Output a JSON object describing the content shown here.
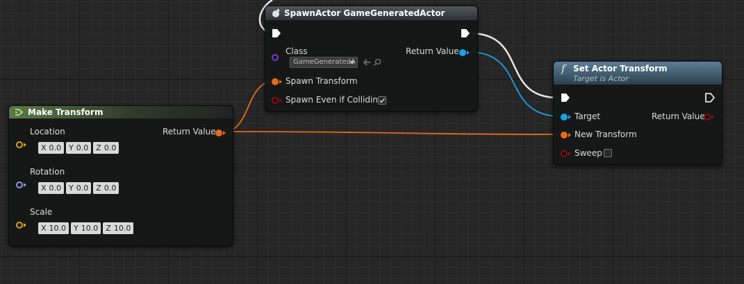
{
  "nodes": {
    "spawn_actor": {
      "title": "SpawnActor GameGeneratedActor",
      "pins": {
        "class_label": "Class",
        "class_value": "GameGeneratedA",
        "return_value": "Return Value",
        "spawn_transform": "Spawn Transform",
        "spawn_even_if_colliding": "Spawn Even if Colliding"
      },
      "spawn_even_if_colliding_checked": true
    },
    "make_transform": {
      "title": "Make Transform",
      "return_value": "Return Value",
      "location": {
        "label": "Location",
        "x": "0.0",
        "y": "0.0",
        "z": "0.0"
      },
      "rotation": {
        "label": "Rotation",
        "x": "0.0",
        "y": "0.0",
        "z": "0.0"
      },
      "scale": {
        "label": "Scale",
        "x": "10.0",
        "y": "10.0",
        "z": "10.0"
      },
      "axis_labels": {
        "x": "X",
        "y": "Y",
        "z": "Z"
      }
    },
    "set_actor_transform": {
      "title": "Set Actor Transform",
      "subtitle": "Target is Actor",
      "target": "Target",
      "return_value": "Return Value",
      "new_transform": "New Transform",
      "sweep": "Sweep",
      "sweep_checked": false
    }
  },
  "colors": {
    "exec_pin": "#ffffff",
    "transform_pin": "#e56c1a",
    "object_pin": "#1aa3e5",
    "class_pin": "#7b3bd6",
    "bool_pin": "#8a1010",
    "vector_pin": "#d8a518",
    "rotator_pin": "#8f97e0"
  },
  "icons": {
    "spawn_node": "spawn-actor-icon",
    "make_node": "make-struct-icon",
    "set_node": "function-icon"
  }
}
